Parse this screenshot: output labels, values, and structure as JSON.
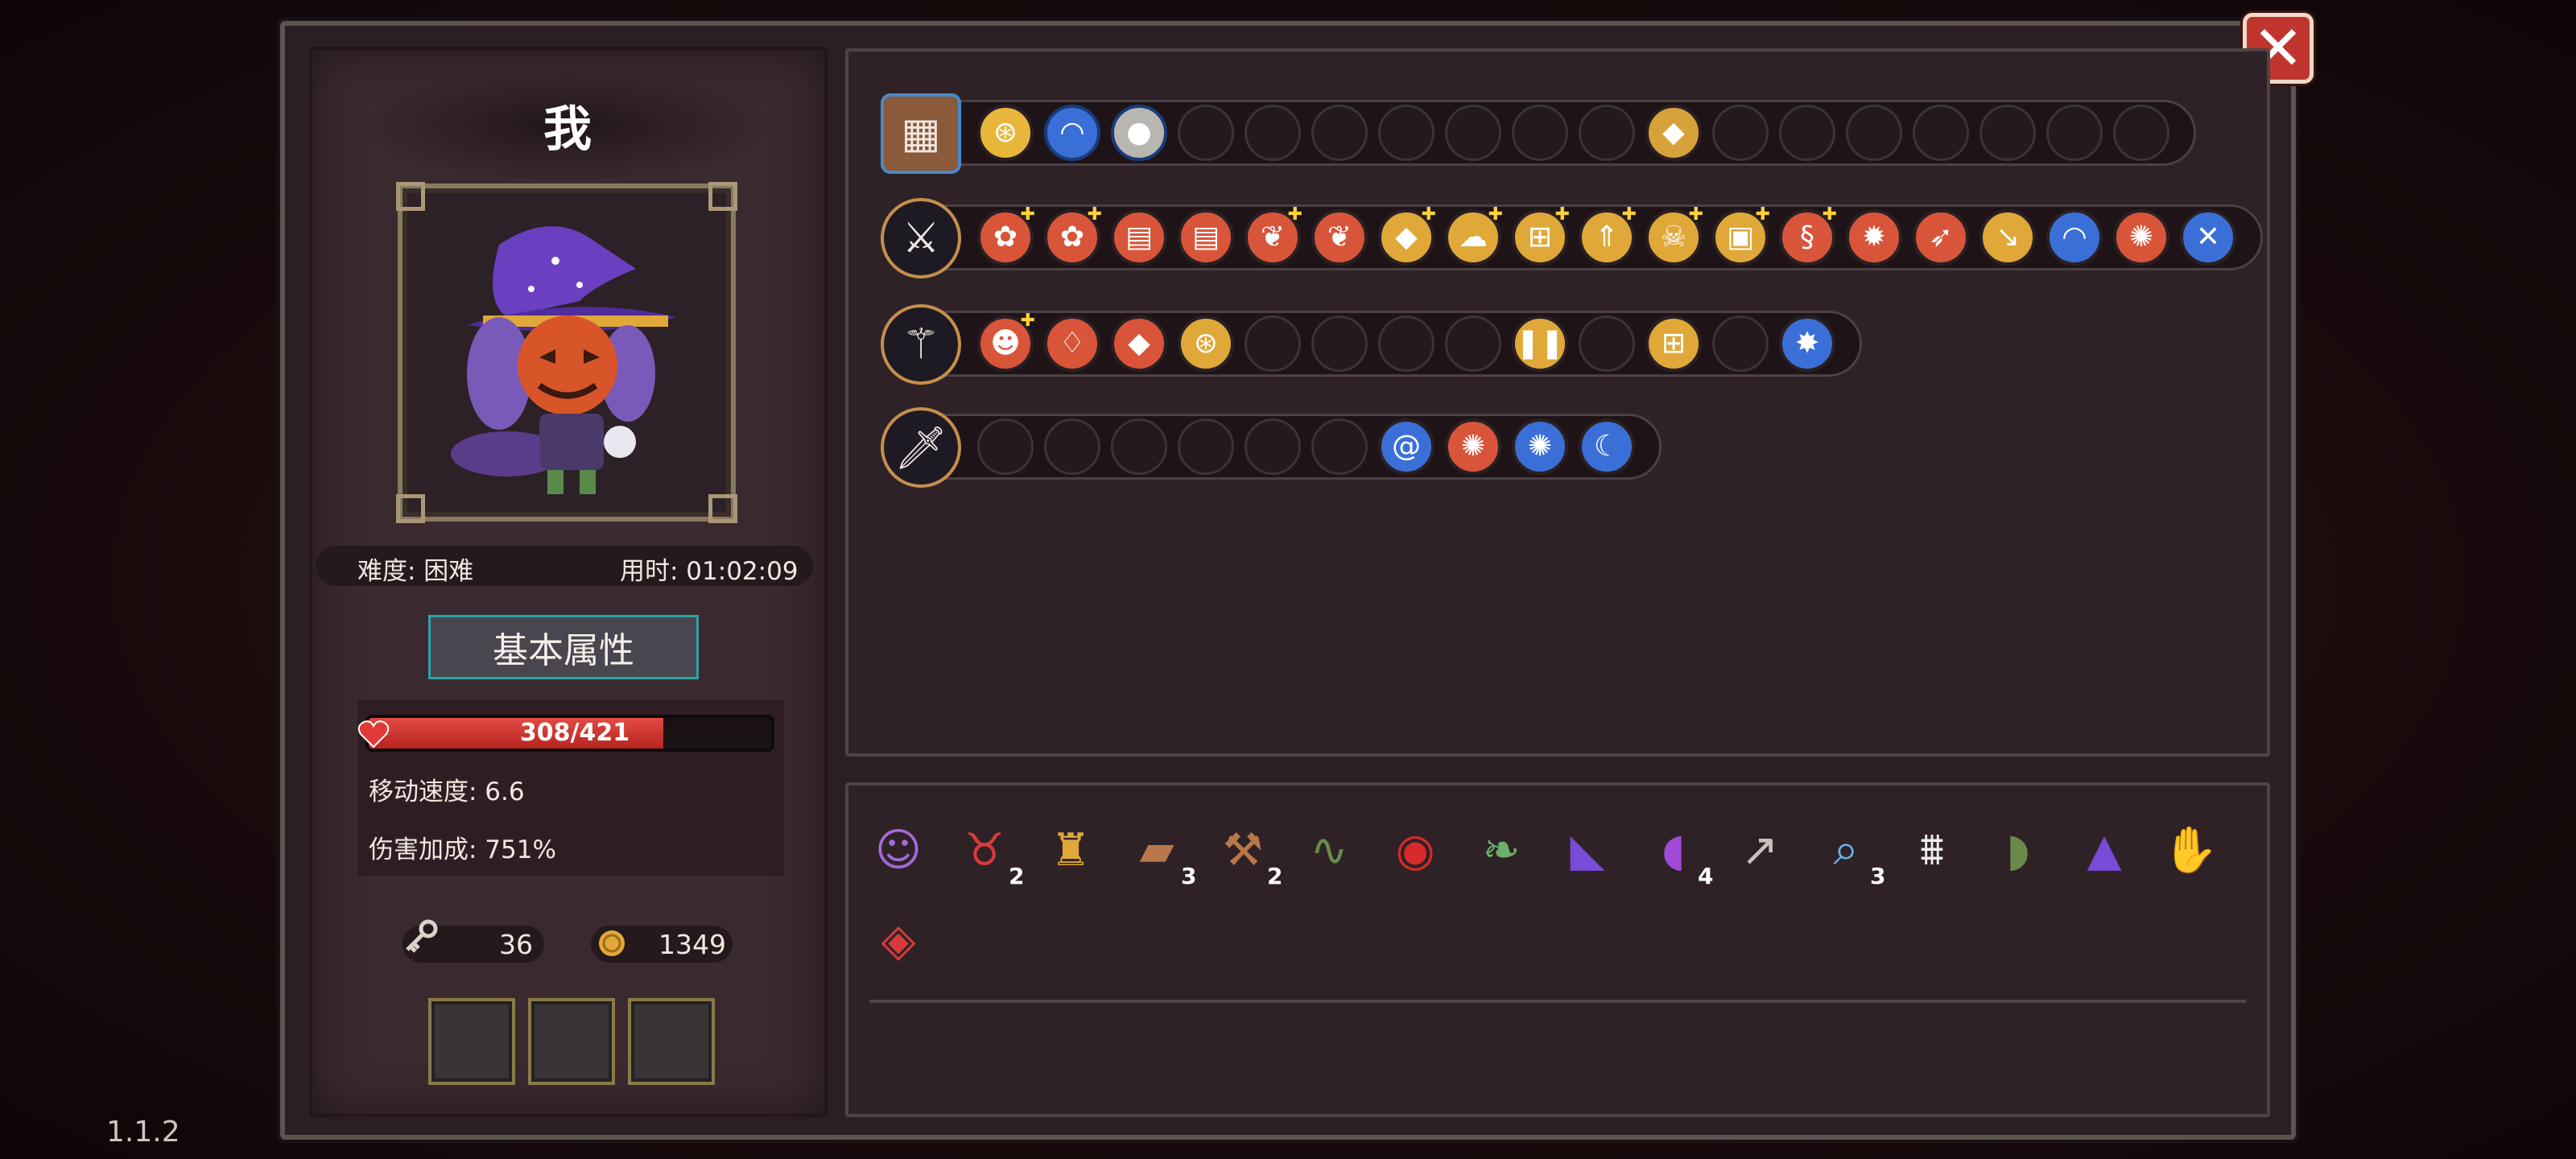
{
  "player": {
    "name": "我",
    "difficulty": "难度: 困难",
    "time": "用时: 01:02:09"
  },
  "attributes": {
    "title": "基本属性",
    "hp_text": "308/421",
    "hp_fraction": 0.7316,
    "move_speed": "移动速度: 6.6",
    "damage_bonus": "伤害加成: 751%"
  },
  "resources": {
    "keys": "36",
    "coins": "1349"
  },
  "version": "1.1.2",
  "colors": {
    "hp": "#d93a33",
    "accent_teal": "#2aa3a8",
    "gold_border": "#c58f4a",
    "close_red": "#c0362f"
  },
  "weapon_rows": [
    {
      "head_icon": "treasure-chest-icon",
      "slots": [
        {
          "icon": "golden-eye-icon",
          "glyph": "⊛",
          "bg": "#e8b63a",
          "ring": "#2a2023"
        },
        {
          "icon": "rainbow-icon",
          "glyph": "◠",
          "bg": "#3b6fd8",
          "ring": "#1a3b7a"
        },
        {
          "icon": "stone-orb-icon",
          "glyph": "●",
          "bg": "#b9b6b2",
          "ring": "#1a3b7a"
        },
        {
          "empty": true
        },
        {
          "empty": true
        },
        {
          "empty": true
        },
        {
          "empty": true
        },
        {
          "empty": true
        },
        {
          "empty": true
        },
        {
          "empty": true
        },
        {
          "icon": "blue-crystal-icon",
          "glyph": "◆",
          "bg": "#d8a23a",
          "ring": "#2a2023"
        },
        {
          "empty": true
        },
        {
          "empty": true
        },
        {
          "empty": true
        },
        {
          "empty": true
        },
        {
          "empty": true
        },
        {
          "empty": true
        },
        {
          "empty": true
        }
      ]
    },
    {
      "head_icon": "magic-sword-icon",
      "slots": [
        {
          "icon": "red-flower-icon",
          "glyph": "✿",
          "bg": "#d8553a",
          "star": true
        },
        {
          "icon": "red-flower-icon",
          "glyph": "✿",
          "bg": "#d8553a",
          "star": true
        },
        {
          "icon": "red-scroll-icon",
          "glyph": "▤",
          "bg": "#d8553a"
        },
        {
          "icon": "red-scroll-icon",
          "glyph": "▤",
          "bg": "#d8553a"
        },
        {
          "icon": "red-seed-icon",
          "glyph": "❦",
          "bg": "#d8553a",
          "star": true
        },
        {
          "icon": "red-seed-icon",
          "glyph": "❦",
          "bg": "#d8553a"
        },
        {
          "icon": "blue-crystal-icon",
          "glyph": "◆",
          "bg": "#e0a838",
          "star": true
        },
        {
          "icon": "gold-cloud-icon",
          "glyph": "☁",
          "bg": "#e0a838",
          "star": true
        },
        {
          "icon": "gold-grid-icon",
          "glyph": "⊞",
          "bg": "#e0a838",
          "star": true
        },
        {
          "icon": "gold-arrow-up-icon",
          "glyph": "⇑",
          "bg": "#e0a838",
          "star": true
        },
        {
          "icon": "green-skull-icon",
          "glyph": "☠",
          "bg": "#e0a838",
          "star": true
        },
        {
          "icon": "gold-card-icon",
          "glyph": "▣",
          "bg": "#e0a838",
          "star": true
        },
        {
          "icon": "red-swirl-icon",
          "glyph": "§",
          "bg": "#d8553a",
          "star": true
        },
        {
          "icon": "red-sun-icon",
          "glyph": "✹",
          "bg": "#d8553a"
        },
        {
          "icon": "red-feather-icon",
          "glyph": "➶",
          "bg": "#d8553a"
        },
        {
          "icon": "gold-arrow-turn-icon",
          "glyph": "↘",
          "bg": "#e0a838"
        },
        {
          "icon": "rainbow-icon",
          "glyph": "◠",
          "bg": "#3b6fd8"
        },
        {
          "icon": "red-burst-icon",
          "glyph": "✺",
          "bg": "#d8553a"
        },
        {
          "icon": "blue-cross-icon",
          "glyph": "✕",
          "bg": "#3b6fd8"
        }
      ]
    },
    {
      "head_icon": "magic-staff-icon",
      "slots": [
        {
          "icon": "pink-spirit-icon",
          "glyph": "☻",
          "bg": "#d8553a",
          "star": true
        },
        {
          "icon": "red-flame-icon",
          "glyph": "♢",
          "bg": "#d8553a"
        },
        {
          "icon": "blue-crystal-icon",
          "glyph": "◆",
          "bg": "#d8553a"
        },
        {
          "icon": "golden-eye-icon",
          "glyph": "⊛",
          "bg": "#e0a838"
        },
        {
          "empty": true
        },
        {
          "empty": true
        },
        {
          "empty": true
        },
        {
          "empty": true
        },
        {
          "icon": "pause-icon",
          "glyph": "❚❚",
          "bg": "#e0a838"
        },
        {
          "empty": true
        },
        {
          "icon": "gold-grid-icon",
          "glyph": "⊞",
          "bg": "#e0a838"
        },
        {
          "empty": true
        },
        {
          "icon": "fireball-icon",
          "glyph": "✸",
          "bg": "#3b6fd8"
        }
      ]
    },
    {
      "head_icon": "ice-dagger-icon",
      "slots": [
        {
          "empty": true
        },
        {
          "empty": true
        },
        {
          "empty": true
        },
        {
          "empty": true
        },
        {
          "empty": true
        },
        {
          "empty": true
        },
        {
          "icon": "purple-vortex-icon",
          "glyph": "@",
          "bg": "#3b6fd8"
        },
        {
          "icon": "red-burst-icon",
          "glyph": "✺",
          "bg": "#d8553a"
        },
        {
          "icon": "violet-orb-icon",
          "glyph": "✺",
          "bg": "#3b6fd8"
        },
        {
          "icon": "blue-scythe-icon",
          "glyph": "☾",
          "bg": "#3b6fd8"
        }
      ]
    }
  ],
  "relics": [
    {
      "icon": "purple-hair-girl-icon",
      "glyph": "☺",
      "color": "#a26ad8",
      "count": ""
    },
    {
      "icon": "red-demon-mask-icon",
      "glyph": "♉",
      "color": "#d83a3a",
      "count": "2"
    },
    {
      "icon": "golden-chalice-icon",
      "glyph": "♜",
      "color": "#e0a838",
      "count": ""
    },
    {
      "icon": "wooden-log-icon",
      "glyph": "▰",
      "color": "#b8774a",
      "count": "3"
    },
    {
      "icon": "pickaxe-icon",
      "glyph": "⚒",
      "color": "#b8774a",
      "count": "2"
    },
    {
      "icon": "green-worm-icon",
      "glyph": "∿",
      "color": "#6b8a4a",
      "count": ""
    },
    {
      "icon": "red-eye-icon",
      "glyph": "◉",
      "color": "#d82a2a",
      "count": ""
    },
    {
      "icon": "green-leaf-icon",
      "glyph": "❧",
      "color": "#6bb06a",
      "count": ""
    },
    {
      "icon": "purple-cape-icon",
      "glyph": "◣",
      "color": "#7a4ad8",
      "count": ""
    },
    {
      "icon": "purple-boot-icon",
      "glyph": "◖",
      "color": "#a04ad8",
      "count": "4"
    },
    {
      "icon": "gray-whip-icon",
      "glyph": "↗",
      "color": "#c8c0bc",
      "count": ""
    },
    {
      "icon": "magnifier-icon",
      "glyph": "⌕",
      "color": "#6ab0e8",
      "count": "3"
    },
    {
      "icon": "white-teeth-icon",
      "glyph": "⩩",
      "color": "#eeeeee",
      "count": ""
    },
    {
      "icon": "green-boot-icon",
      "glyph": "◗",
      "color": "#6b8a4a",
      "count": ""
    },
    {
      "icon": "purple-witch-hat-icon",
      "glyph": "▲",
      "color": "#7a4ad8",
      "count": ""
    },
    {
      "icon": "gray-claw-icon",
      "glyph": "✋",
      "color": "#9a98a0",
      "count": ""
    },
    {
      "icon": "red-gem-icon",
      "glyph": "◈",
      "color": "#d83a3a",
      "count": ""
    }
  ]
}
